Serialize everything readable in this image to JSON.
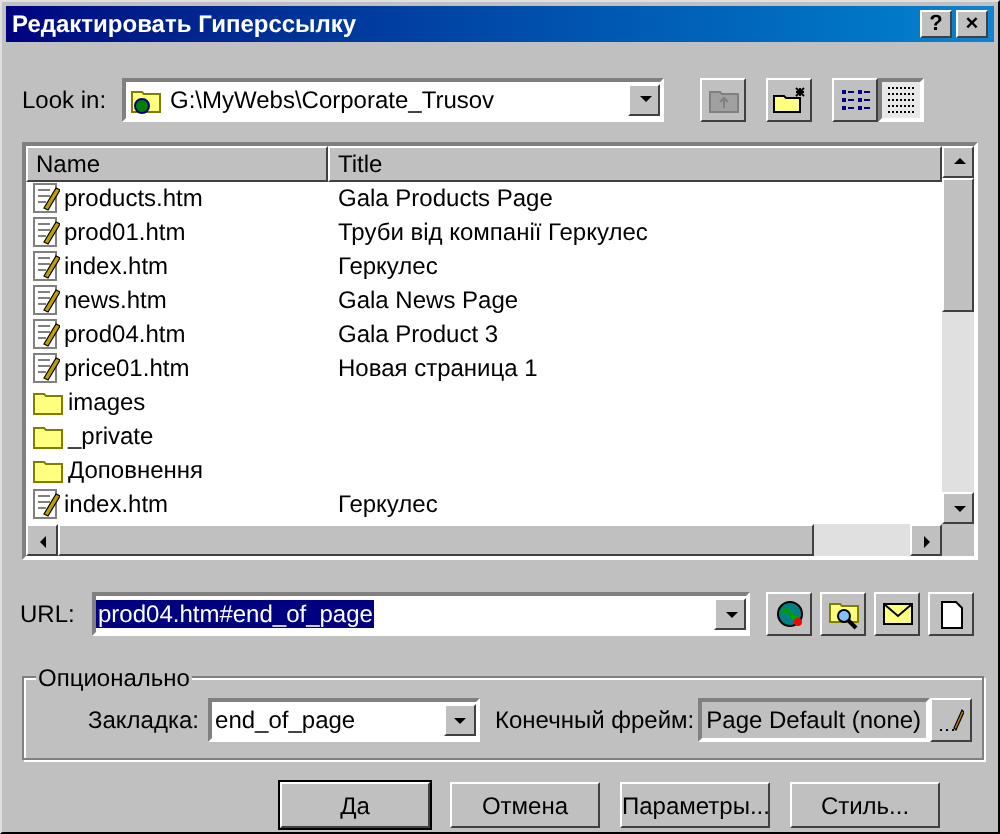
{
  "window": {
    "title": "Редактировать Гиперссылку",
    "title_buttons": [
      "?",
      "×"
    ]
  },
  "look_in": {
    "label": "Look in:",
    "value": "G:\\MyWebs\\Corporate_Trusov"
  },
  "toolbar": [
    {
      "kind": "up",
      "disabled": true,
      "pressed": false
    },
    {
      "kind": "new_folder",
      "disabled": false,
      "pressed": false
    },
    {
      "kind": "list",
      "disabled": false,
      "pressed": false
    },
    {
      "kind": "details",
      "disabled": false,
      "pressed": true
    }
  ],
  "files": {
    "columns": [
      "Name",
      "Title"
    ],
    "rows": [
      {
        "kind": "page",
        "name": "products.htm",
        "title": "Gala Products Page"
      },
      {
        "kind": "page",
        "name": "prod01.htm",
        "title": "Труби від компанії Геркулес"
      },
      {
        "kind": "page",
        "name": "index.htm",
        "title": "Геркулес"
      },
      {
        "kind": "page",
        "name": "news.htm",
        "title": "Gala News Page"
      },
      {
        "kind": "page",
        "name": "prod04.htm",
        "title": "Gala Product 3"
      },
      {
        "kind": "page",
        "name": "price01.htm",
        "title": "Новая страница 1"
      },
      {
        "kind": "folder",
        "name": "images"
      },
      {
        "kind": "folder",
        "name": "_private"
      },
      {
        "kind": "folder",
        "name": "Доповнення"
      },
      {
        "kind": "page",
        "name": "index.htm",
        "title": "Геркулес"
      }
    ]
  },
  "url": {
    "label": "URL:",
    "value": "prod04.htm#end_of_page",
    "selected": true
  },
  "url_buttons": [
    {
      "kind": "web"
    },
    {
      "kind": "browse"
    },
    {
      "kind": "mail"
    },
    {
      "kind": "new_page"
    }
  ],
  "optional": {
    "title": "Опционально",
    "bookmark_label": "Закладка:",
    "bookmark_value": "end_of_page",
    "frame_label": "Конечный фрейм:",
    "frame_value": "Page Default (none)"
  },
  "buttons": [
    {
      "label": "Да",
      "default": true
    },
    {
      "label": "Отмена",
      "default": false
    },
    {
      "label": "Параметры...",
      "default": false
    },
    {
      "label": "Стиль...",
      "default": false
    }
  ]
}
